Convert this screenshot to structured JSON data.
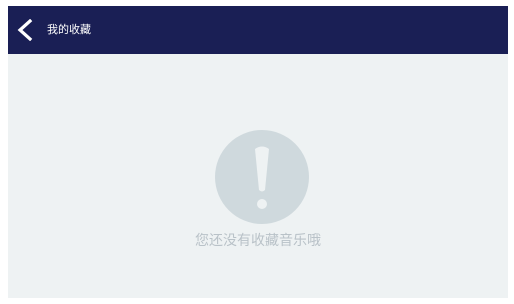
{
  "header": {
    "back_icon": "chevron-left-icon",
    "title": "我的收藏"
  },
  "empty_state": {
    "icon": "exclamation-circle-icon",
    "message": "您还没有收藏音乐哦"
  },
  "colors": {
    "header_bg": "#1a1f55",
    "page_bg": "#eef2f3",
    "icon_circle": "#cfd9dd",
    "message_text": "#b9c2c8",
    "header_text": "#ffffff"
  }
}
